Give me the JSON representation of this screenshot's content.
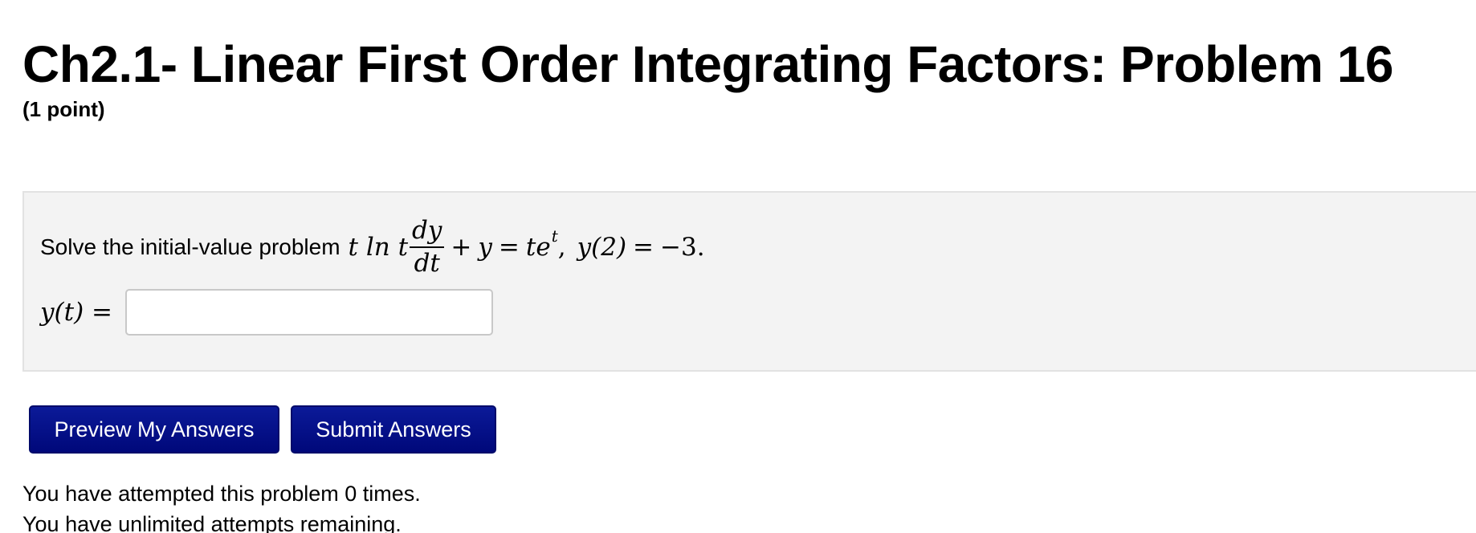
{
  "problem": {
    "title": "Ch2.1- Linear First Order Integrating Factors: Problem 16",
    "points": "(1 point)",
    "statement_text": "Solve the initial-value problem",
    "equation": {
      "coef": "t ln t",
      "frac_num": "dy",
      "frac_den": "dt",
      "plus": "+",
      "y": "y",
      "eq1": "=",
      "te": "te",
      "exponent": "t",
      "comma": ",",
      "ic_lhs": "y(2)",
      "eq2": "=",
      "ic_rhs": "−3."
    },
    "answer_label": "y(t) =",
    "answer_value": ""
  },
  "buttons": {
    "preview_label": "Preview My Answers",
    "submit_label": "Submit Answers"
  },
  "attempts": {
    "line1": "You have attempted this problem 0 times.",
    "line2": "You have unlimited attempts remaining."
  },
  "colors": {
    "button_bg": "#00087a",
    "panel_bg": "#f3f3f3",
    "panel_border": "#e2e2e2"
  }
}
